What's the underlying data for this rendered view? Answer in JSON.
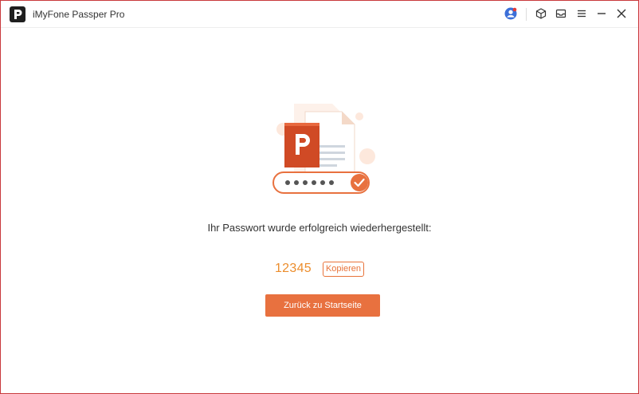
{
  "app": {
    "title": "iMyFone Passper Pro",
    "logo_letter": "P"
  },
  "titlebar": {
    "icons": [
      "user-avatar-icon",
      "cube-icon",
      "mail-icon",
      "menu-icon",
      "minimize-icon",
      "close-icon"
    ]
  },
  "result": {
    "message": "Ihr Passwort wurde erfolgreich wiederhergestellt:",
    "password": "12345",
    "copy_label": "Kopieren",
    "back_label": "Zurück zu Startseite"
  },
  "colors": {
    "accent": "#e8713f",
    "password": "#ec8d2c",
    "window_border": "#c9393c",
    "powerpoint": "#d04a25"
  }
}
